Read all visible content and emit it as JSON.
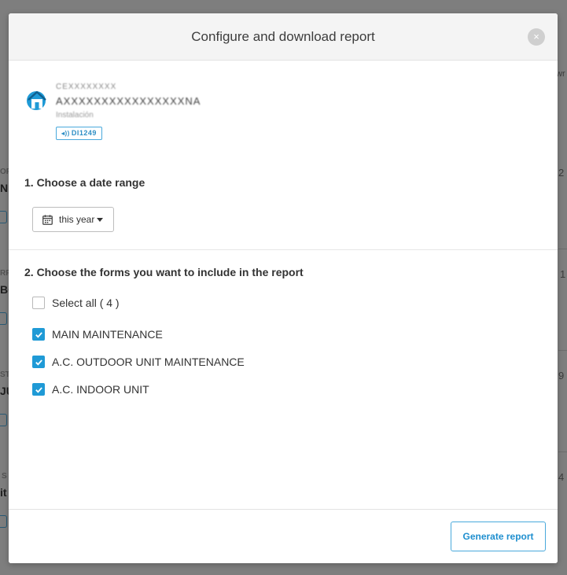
{
  "background": {
    "fragments": [
      "wr",
      "OR",
      "N",
      "RR",
      "BC",
      "ST",
      "JU",
      "S",
      "it",
      "2",
      "1",
      "9",
      "4"
    ]
  },
  "modal": {
    "title": "Configure and download report",
    "close_symbol": "×",
    "site": {
      "line1": "CEXXXXXXXX",
      "line2": "AXXXXXXXXXXXXXXXXNA",
      "line3": "Instalación",
      "device_badge": "DI1249",
      "icon": "home-icon"
    },
    "section1": {
      "title": "1. Choose a date range"
    },
    "date_range": {
      "label": "this year",
      "icon": "calendar-icon"
    },
    "section2": {
      "title": "2. Choose the forms you want to include in the report"
    },
    "select_all": {
      "label": "Select all ( 4 )",
      "checked": false
    },
    "forms": [
      {
        "label": "MAIN MAINTENANCE",
        "checked": true
      },
      {
        "label": "A.C. OUTDOOR UNIT MAINTENANCE",
        "checked": true
      },
      {
        "label": "A.C. INDOOR UNIT",
        "checked": true
      }
    ],
    "footer": {
      "generate_label": "Generate report"
    }
  },
  "colors": {
    "accent": "#1f9ad6",
    "accent_border": "#49a9dc"
  }
}
